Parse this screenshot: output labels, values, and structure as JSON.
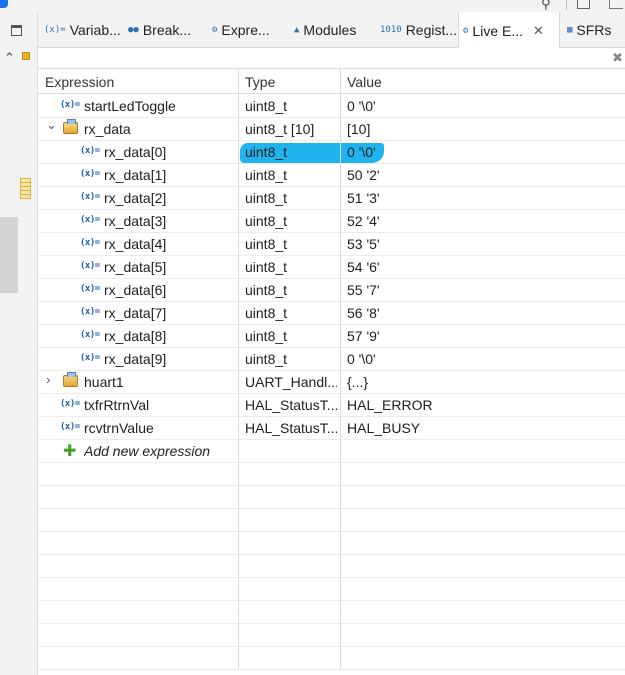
{
  "tabs": [
    {
      "icon": "(x)=",
      "label": "Variab..."
    },
    {
      "icon": "●●",
      "label": "Break..."
    },
    {
      "icon": "⚙",
      "label": "Expre..."
    },
    {
      "icon": "▲",
      "label": "Modules"
    },
    {
      "icon": "1010",
      "label": "Regist..."
    },
    {
      "icon": "⚙",
      "label": "Live E...",
      "active": true,
      "close": "✕"
    },
    {
      "icon": "▦",
      "label": "SFRs"
    }
  ],
  "columns": {
    "expression": "Expression",
    "type": "Type",
    "value": "Value"
  },
  "rows": [
    {
      "indent": 0,
      "kind": "var",
      "name": "startLedToggle",
      "type": "uint8_t",
      "value": "0 '\\0'"
    },
    {
      "indent": 0,
      "kind": "struct",
      "expanded": true,
      "name": "rx_data",
      "type": "uint8_t [10]",
      "value": "[10]"
    },
    {
      "indent": 1,
      "kind": "var",
      "name": "rx_data[0]",
      "type": "uint8_t",
      "value": "0 '\\0'",
      "highlighted": true
    },
    {
      "indent": 1,
      "kind": "var",
      "name": "rx_data[1]",
      "type": "uint8_t",
      "value": "50 '2'"
    },
    {
      "indent": 1,
      "kind": "var",
      "name": "rx_data[2]",
      "type": "uint8_t",
      "value": "51 '3'"
    },
    {
      "indent": 1,
      "kind": "var",
      "name": "rx_data[3]",
      "type": "uint8_t",
      "value": "52 '4'"
    },
    {
      "indent": 1,
      "kind": "var",
      "name": "rx_data[4]",
      "type": "uint8_t",
      "value": "53 '5'"
    },
    {
      "indent": 1,
      "kind": "var",
      "name": "rx_data[5]",
      "type": "uint8_t",
      "value": "54 '6'"
    },
    {
      "indent": 1,
      "kind": "var",
      "name": "rx_data[6]",
      "type": "uint8_t",
      "value": "55 '7'"
    },
    {
      "indent": 1,
      "kind": "var",
      "name": "rx_data[7]",
      "type": "uint8_t",
      "value": "56 '8'"
    },
    {
      "indent": 1,
      "kind": "var",
      "name": "rx_data[8]",
      "type": "uint8_t",
      "value": "57 '9'"
    },
    {
      "indent": 1,
      "kind": "var",
      "name": "rx_data[9]",
      "type": "uint8_t",
      "value": "0 '\\0'"
    },
    {
      "indent": 0,
      "kind": "struct",
      "expanded": false,
      "name": "huart1",
      "type": "UART_Handl...",
      "value": "{...}"
    },
    {
      "indent": 0,
      "kind": "var",
      "name": "txfrRtrnVal",
      "type": "HAL_StatusT...",
      "value": "HAL_ERROR"
    },
    {
      "indent": 0,
      "kind": "var",
      "name": "rcvtrnValue",
      "type": "HAL_StatusT...",
      "value": "HAL_BUSY"
    },
    {
      "indent": 0,
      "kind": "add",
      "name": "Add new expression",
      "type": "",
      "value": ""
    }
  ],
  "icons": {
    "var": "(x)=",
    "expanded": "⌄",
    "collapsed": "›",
    "add": "✚"
  },
  "empty_rows": 9,
  "colors": {
    "highlight": "#1fb4ee",
    "var_icon": "#1b5fb0",
    "add_icon": "#4aa02c"
  }
}
